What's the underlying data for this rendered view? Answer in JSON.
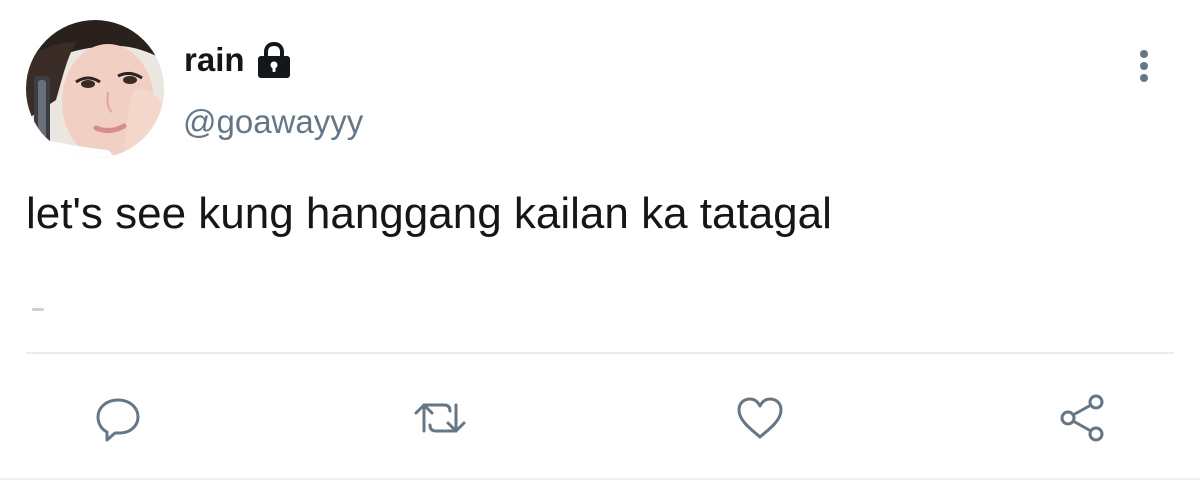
{
  "tweet": {
    "author": {
      "display_name": "rain",
      "handle": "@goawayyy",
      "protected_icon": "lock-icon"
    },
    "text": "let's see kung hanggang kailan ka tatagal",
    "menu_icon": "more-vertical-icon",
    "actions": [
      {
        "name": "reply",
        "icon": "reply-icon"
      },
      {
        "name": "retweet",
        "icon": "retweet-icon"
      },
      {
        "name": "like",
        "icon": "heart-icon"
      },
      {
        "name": "share",
        "icon": "share-icon"
      }
    ]
  },
  "colors": {
    "text_primary": "#14171a",
    "text_secondary": "#657786",
    "icon_gray": "#657786",
    "divider": "#e6ecf0",
    "background": "#ffffff"
  }
}
